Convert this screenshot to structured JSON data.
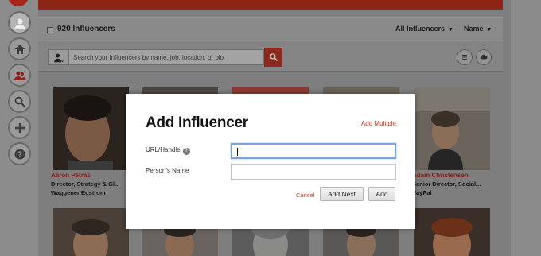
{
  "header": {
    "count_label": "920 Influencers",
    "filter_all": "All Influencers",
    "filter_sort": "Name"
  },
  "search": {
    "placeholder": "Search your Influencers by name, job, location, or bio"
  },
  "cards": [
    {
      "name": "Aaron Petras",
      "line1": "Director, Strategy & Gl...",
      "line2": "Waggener Edstrom"
    },
    {
      "name": "Adam Christensen",
      "line1": "Senior Director, Social...",
      "line2": "PayPal"
    }
  ],
  "modal": {
    "title": "Add Influencer",
    "add_multiple": "Add Multiple",
    "url_label": "URL/Handle",
    "url_value": "",
    "name_label": "Person's Name",
    "name_value": "",
    "cancel": "Cancel",
    "add_next": "Add Next",
    "add": "Add"
  },
  "colors": {
    "accent": "#d23a24",
    "focus_border": "#7aa7d8"
  },
  "icons": [
    "avatar-icon",
    "home-icon",
    "influencers-icon",
    "search-icon",
    "add-icon",
    "help-icon",
    "person-icon",
    "list-view-icon",
    "cloud-icon"
  ]
}
